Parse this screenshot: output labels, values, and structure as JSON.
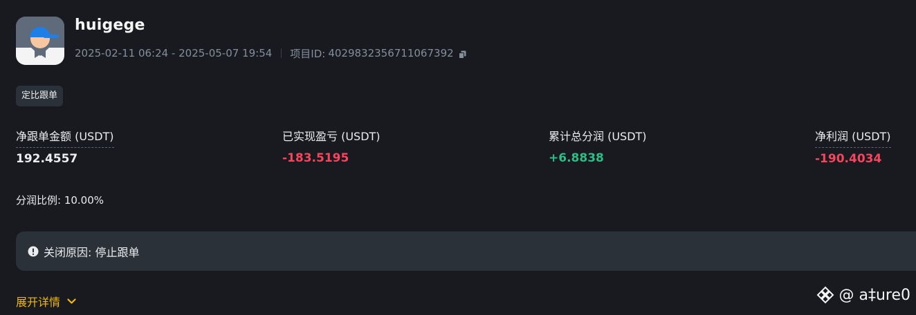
{
  "header": {
    "name": "huigege",
    "date_range": "2025-02-11 06:24 - 2025-05-07 19:54",
    "project_id_label": "项目ID:",
    "project_id": "4029832356711067392"
  },
  "tag": "定比跟单",
  "stats": [
    {
      "label": "净跟单金额 (USDT)",
      "value": "192.4557",
      "color": "#eaecef"
    },
    {
      "label": "已实现盈亏 (USDT)",
      "value": "-183.5195",
      "color": "#f6465d"
    },
    {
      "label": "累计总分润 (USDT)",
      "value": "+6.8838",
      "color": "#2ebd85"
    },
    {
      "label": "净利润 (USDT)",
      "value": "-190.4034",
      "color": "#f6465d"
    }
  ],
  "profit_share": "分润比例: 10.00%",
  "close_reason": "关闭原因: 停止跟单",
  "expand_label": "展开详情",
  "watermark": "@ a‡ure0",
  "icons": {
    "copy": "copy-icon",
    "alert": "alert-circle-icon",
    "chevron": "chevron-down-icon",
    "logo": "binance-logo-icon"
  },
  "colors": {
    "background": "#181a20",
    "panel": "#2b3139",
    "accent": "#f0b90b",
    "positive": "#2ebd85",
    "negative": "#f6465d"
  }
}
